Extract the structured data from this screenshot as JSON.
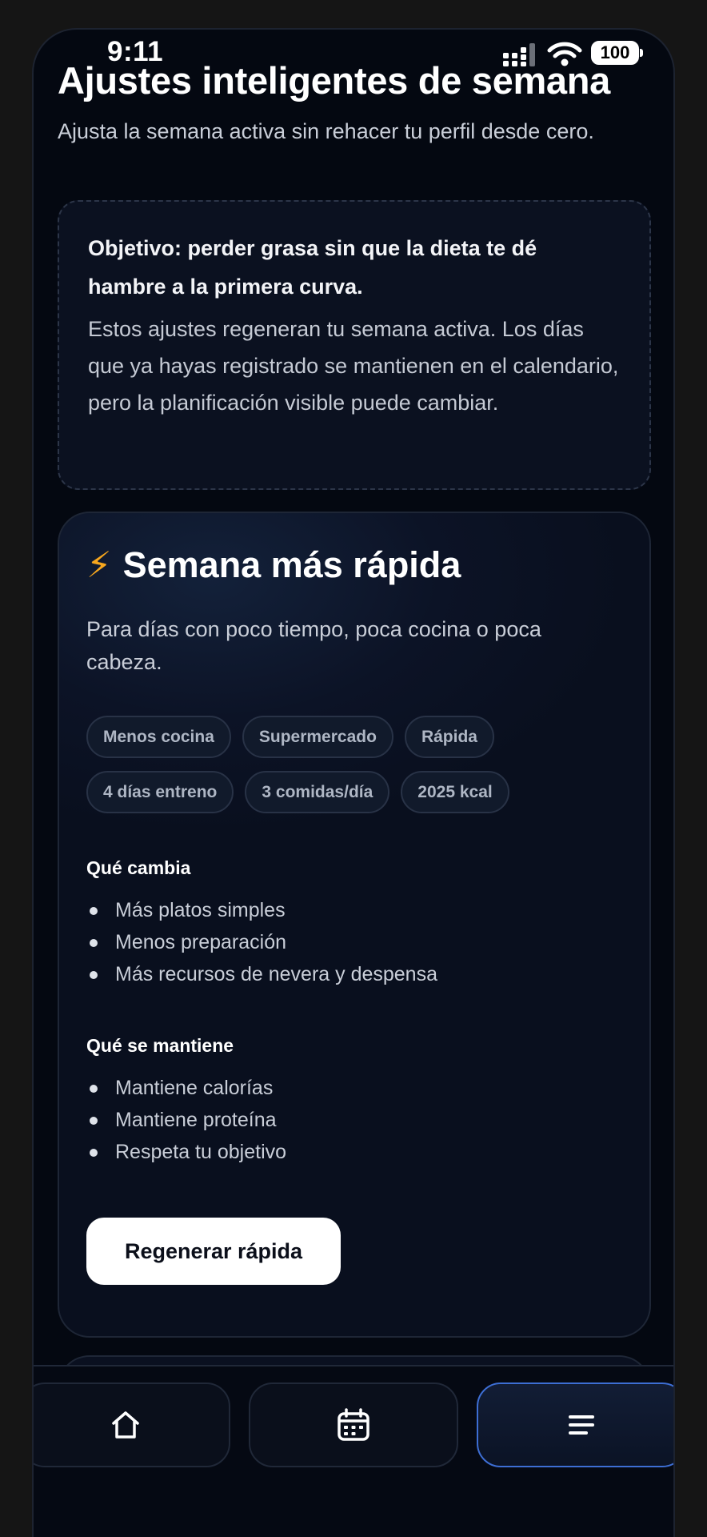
{
  "status_bar": {
    "time": "9:11",
    "battery": "100"
  },
  "header": {
    "title": "Ajustes inteligentes de semana",
    "subtitle": "Ajusta la semana activa sin rehacer tu perfil desde cero."
  },
  "info_box": {
    "goal": "Objetivo: perder grasa sin que la dieta te dé hambre a la primera curva.",
    "note": "Estos ajustes regeneran tu semana activa. Los días que ya hayas registrado se mantienen en el calendario, pero la planificación visible puede cambiar."
  },
  "option_card": {
    "icon": "⚡",
    "title": "Semana más rápida",
    "description": "Para días con poco tiempo, poca cocina o poca cabeza.",
    "tags": [
      "Menos cocina",
      "Supermercado",
      "Rápida",
      "4 días entreno",
      "3 comidas/día",
      "2025 kcal"
    ],
    "changes_label": "Qué cambia",
    "changes": [
      "Más platos simples",
      "Menos preparación",
      "Más recursos de nevera y despensa"
    ],
    "keeps_label": "Qué se mantiene",
    "keeps": [
      "Mantiene calorías",
      "Mantiene proteína",
      "Respeta tu objetivo"
    ],
    "button_label": "Regenerar rápida"
  },
  "tab_bar": {
    "tabs": [
      {
        "icon": "home-icon",
        "active": false
      },
      {
        "icon": "calendar-icon",
        "active": false
      },
      {
        "icon": "menu-icon",
        "active": true
      }
    ],
    "active_color": "#3d6ed4"
  },
  "colors": {
    "background": "#040811",
    "bolt": "#f7a71e",
    "button_bg": "#ffffff"
  }
}
